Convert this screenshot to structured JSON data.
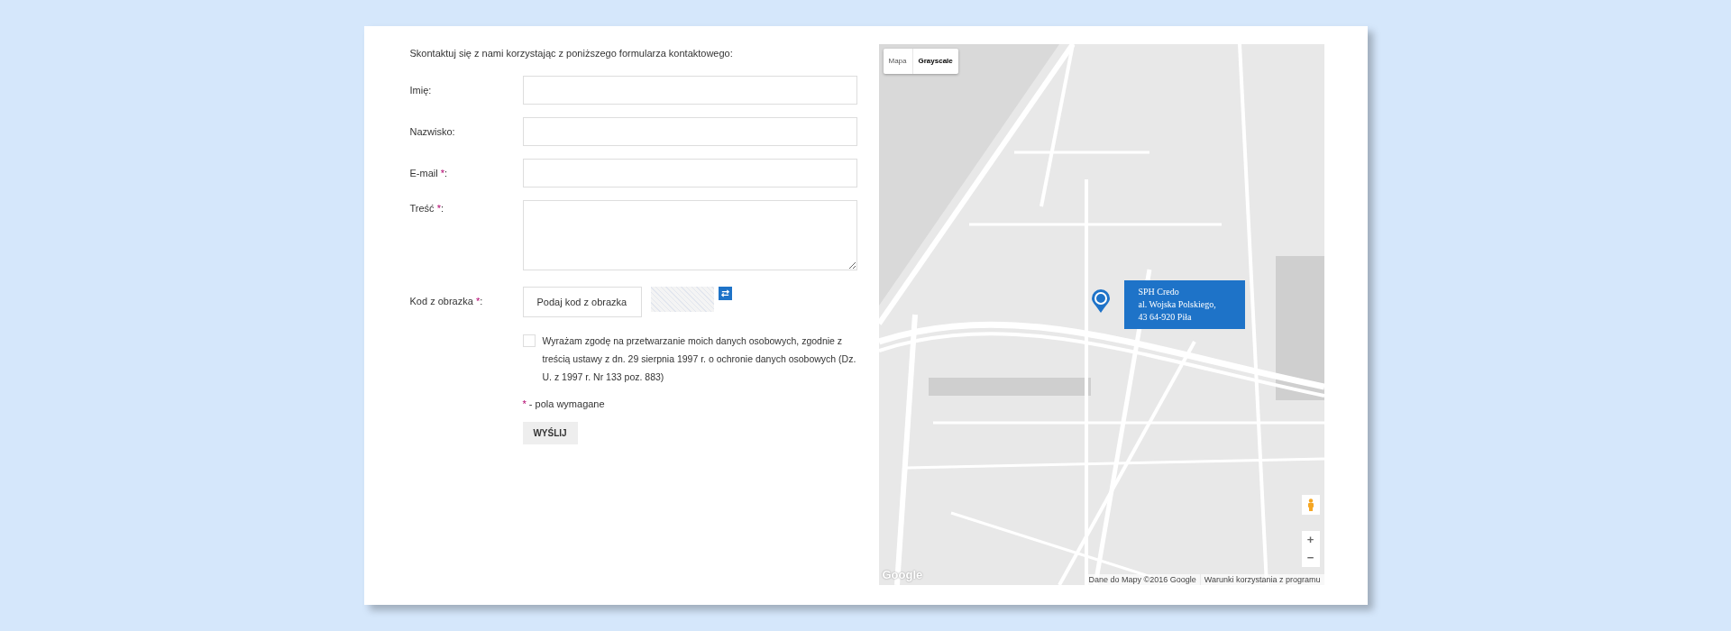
{
  "form": {
    "intro": "Skontaktuj się z nami korzystając z poniższego formularza kontaktowego:",
    "fields": [
      {
        "kind": "input",
        "label": "Imię",
        "suffix": ":"
      },
      {
        "kind": "input",
        "label": "Nazwisko",
        "suffix": ":"
      },
      {
        "kind": "input",
        "label": "E-mail ",
        "mark": "*",
        "suffix": ":"
      },
      {
        "kind": "textarea",
        "label": "Treść ",
        "mark": "*",
        "suffix": ":"
      },
      {
        "kind": "captcha",
        "label": "Kod z obrazka ",
        "mark": "*",
        "suffix": ":",
        "placeholder": "Podaj kod z obrazka"
      }
    ],
    "consent": {
      "checked": false,
      "text": "Wyrażam zgodę na przetwarzanie moich danych osobowych, zgodnie z treścią ustawy z dn. 29 sierpnia 1997 r. o ochronie danych osobowych (Dz. U. z 1997 r. Nr 133 poz. 883)"
    },
    "required_note": {
      "mark": "*",
      "text": " - pola wymagane"
    },
    "submit": "WYŚLIJ"
  },
  "map": {
    "types": [
      {
        "label": "Mapa",
        "selected": false
      },
      {
        "label": "Grayscale",
        "selected": true
      }
    ],
    "info": [
      "SPH Credo",
      "al. Wojska Polskiego,",
      "43 64-920 Piła"
    ],
    "zoom": [
      "+",
      "−"
    ],
    "logo": "Google",
    "attribution": [
      "Dane do Mapy ©2016 Google",
      "Warunki korzystania z programu"
    ]
  }
}
